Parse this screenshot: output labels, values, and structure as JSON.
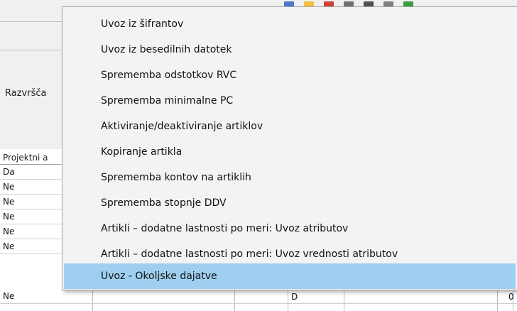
{
  "background": {
    "sort_label": "Razvršča",
    "grid_header": "Projektni a",
    "rows": [
      "Da",
      "Ne",
      "Ne",
      "Ne",
      "Ne",
      "Ne",
      "Ne"
    ],
    "last_row_code": "D",
    "last_row_value": "0",
    "toolbar_icon_colors": [
      "#4a78c6",
      "#f0c040",
      "#d04030",
      "#707070",
      "#505050",
      "#808080",
      "#3a9a40"
    ]
  },
  "context_menu": {
    "items": [
      "Uvoz iz šifrantov",
      "Uvoz iz besedilnih datotek",
      "Sprememba odstotkov RVC",
      "Sprememba minimalne PC",
      "Aktiviranje/deaktiviranje artiklov",
      "Kopiranje artikla",
      "Sprememba kontov na artiklih",
      "Sprememba stopnje DDV",
      "Artikli – dodatne lastnosti po meri: Uvoz atributov",
      "Artikli – dodatne lastnosti po meri: Uvoz vrednosti atributov",
      "Uvoz - Okoljske dajatve"
    ],
    "highlighted_index": 10,
    "highlight_color": "#9ecff0"
  }
}
